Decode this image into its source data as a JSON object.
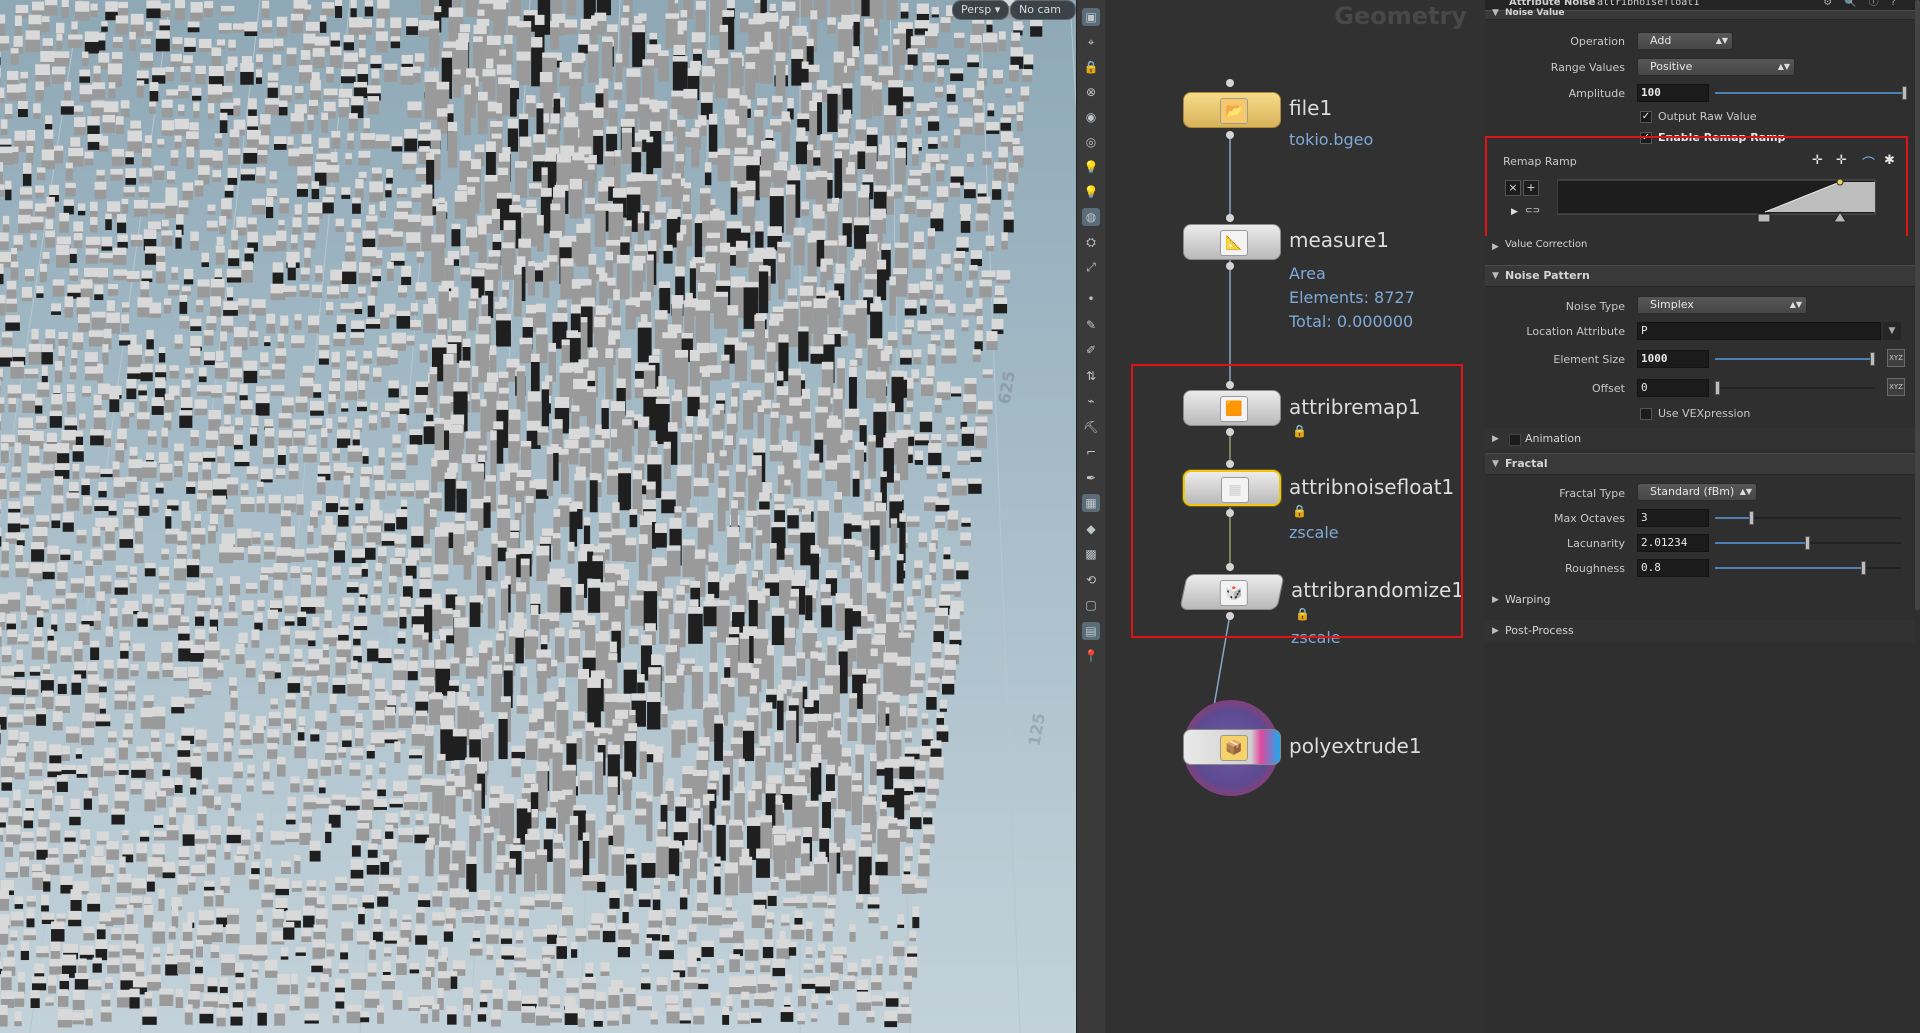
{
  "viewport": {
    "camera_menu": "Persp ▾",
    "cam_menu": "No cam ▾",
    "grid_labels": [
      "625",
      "125"
    ]
  },
  "toolbar": {
    "icons": [
      "select-icon",
      "view-icon",
      "lock-icon",
      "snap-icon",
      "ghost-icon",
      "display-icon",
      "light-icon",
      "light2-icon",
      "camera-icon",
      "handle-icon",
      "transform-icon",
      "point-icon",
      "edit-icon",
      "brush-icon",
      "sort-icon",
      "paint-icon",
      "sculpt-icon",
      "curve-icon",
      "pen-icon",
      "grid-icon",
      "shade-icon",
      "texture-icon",
      "bone-icon",
      "box-icon",
      "render-icon",
      "pin-icon"
    ]
  },
  "network": {
    "title": "Geometry",
    "nodes": [
      {
        "name": "file1",
        "sub": [
          "tokio.bgeo"
        ],
        "icon": "folder-icon"
      },
      {
        "name": "measure1",
        "sub": [
          "Area",
          "Elements: 8727",
          "Total: 0.000000"
        ],
        "icon": "measure-icon"
      },
      {
        "name": "attribremap1",
        "sub": [],
        "icon": "remap-icon"
      },
      {
        "name": "attribnoisefloat1",
        "sub": [
          "zscale"
        ],
        "icon": "noise-icon"
      },
      {
        "name": "attribrandomize1",
        "sub": [
          "zscale"
        ],
        "icon": "randomize-icon"
      },
      {
        "name": "polyextrude1",
        "sub": [],
        "icon": "extrude-icon"
      }
    ]
  },
  "params": {
    "header_type": "Attribute Noise",
    "header_name": "attribnoisefloat1",
    "noise_value_section": "Noise Value",
    "operation": {
      "label": "Operation",
      "value": "Add"
    },
    "range_values": {
      "label": "Range Values",
      "value": "Positive"
    },
    "amplitude": {
      "label": "Amplitude",
      "value": "100",
      "fraction": 1.0
    },
    "output_raw": {
      "label": "Output Raw Value",
      "checked": true
    },
    "enable_remap": {
      "label": "Enable Remap Ramp",
      "checked": true
    },
    "remap_ramp": {
      "label": "Remap Ramp"
    },
    "value_correction": "Value Correction",
    "noise_pattern_section": "Noise Pattern",
    "noise_type": {
      "label": "Noise Type",
      "value": "Simplex"
    },
    "location_attr": {
      "label": "Location Attribute",
      "value": "P"
    },
    "element_size": {
      "label": "Element Size",
      "value": "1000",
      "fraction": 0.99
    },
    "offset": {
      "label": "Offset",
      "value": "0",
      "fraction": 0.0
    },
    "use_vexpression": {
      "label": "Use VEXpression",
      "checked": false
    },
    "animation": "Animation",
    "fractal_section": "Fractal",
    "fractal_type": {
      "label": "Fractal Type",
      "value": "Standard (fBm)"
    },
    "max_octaves": {
      "label": "Max Octaves",
      "value": "3",
      "fraction": 0.2
    },
    "lacunarity": {
      "label": "Lacunarity",
      "value": "2.01234",
      "fraction": 0.5
    },
    "roughness": {
      "label": "Roughness",
      "value": "0.8",
      "fraction": 0.8
    },
    "warping": "Warping",
    "post_process": "Post-Process"
  },
  "colors": {
    "highlight": "#e01414",
    "selected_node": "#f0c419",
    "link": "#7fa9d6"
  }
}
